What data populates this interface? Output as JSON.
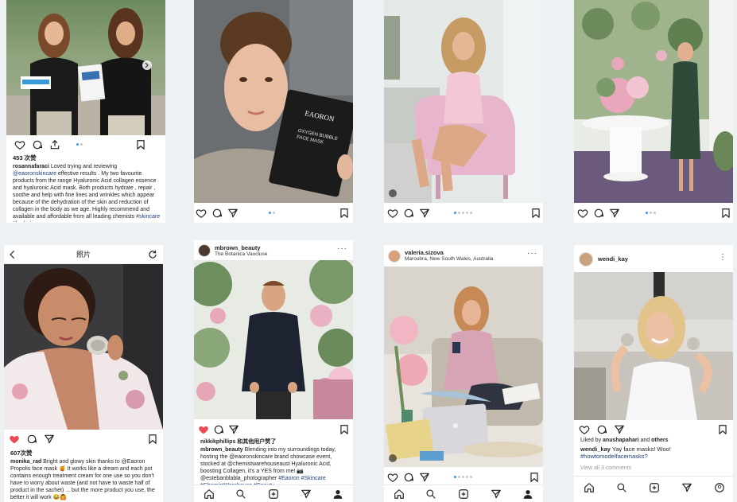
{
  "posts": {
    "p1": {
      "likes": "453 次赞",
      "username": "rosannafaraci",
      "caption": " Loved trying and reviewing ",
      "mention": "@eaoronskincare",
      "caption2": " effective results . My two favourite products from the range Hyaluronic Acid collagen essence and hyaluronic Acid mask. Both products hydrate , repair , soothe and help with fine lines and wrinkles which appear because of the dehydration of the skin and reduction of collagen in the body as we age. Highly recommend and available and affordable from all leading chemists ",
      "tags": "#skincare #hydration"
    },
    "p2": {
      "mask_brand": "EAORON",
      "mask_line1": "OXYGEN BUBBLE",
      "mask_line2": "FACE MASK"
    },
    "p5": {
      "title": "照片",
      "likes": "607次赞",
      "username": "monika_rad",
      "caption": " Bright and glowy skin thanks to @Eaoron Propolis face mask 🍯 It works like a dream and each pot contains enough treatment cream for one use so you don't have to worry about waste (and not have to waste half of product in the sachet) ... but the more product you use, the better it will work 😂🙆"
    },
    "p6": {
      "username": "mbrown_beauty",
      "location": "The Botanica Vaucluse",
      "liked_by": "nikkikphillips 和其他用户赞了",
      "cap_user": "mbrown_beauty",
      "caption": " Blending into my surroundings today, hosting the @eaoronskincare brand showcase event, stocked at @chemistwarehouseaust Hyaluronic Acid, boosting Collagen, it's a YES from me! 📷 @estebanblabla_photographer",
      "tags": "#Eaoron #Skincare #ChemistWarehouse #Beauty"
    },
    "p7": {
      "username": "valeria.sizova",
      "location": "Maroubra, New South Wales, Australia"
    },
    "p8": {
      "username": "wendi_kay",
      "liked_by_prefix": "Liked by ",
      "liked_user": "anushapahari",
      "liked_and": " and ",
      "liked_others": "others",
      "cap_user": "wendi_kay",
      "caption": " Yay face masks! Woo!",
      "tag": "#howtomodelfacemasks?",
      "comments": "View all 3 comments"
    }
  },
  "colors": {
    "heart_red": "#ed4956",
    "link_blue": "#1d3f7a",
    "dot_active": "#3897f0"
  },
  "icons": [
    "heart-icon",
    "comment-icon",
    "share-icon",
    "bookmark-icon",
    "home-icon",
    "search-icon",
    "add-icon",
    "profile-icon",
    "back-icon",
    "refresh-icon"
  ]
}
